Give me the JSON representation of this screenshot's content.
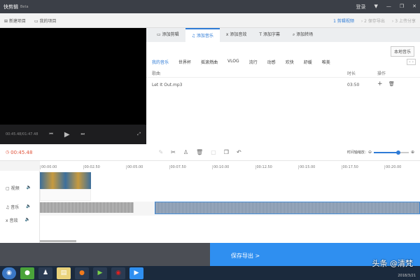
{
  "app": {
    "title": "快剪辑",
    "badge": "Beta",
    "login": "登录",
    "win_controls": [
      "▼",
      "—",
      "❐",
      "✕"
    ]
  },
  "toolbar": {
    "new_project": "新建项目",
    "my_projects": "我的项目",
    "steps": [
      {
        "num": "1",
        "label": "剪辑视频"
      },
      {
        "num": "2",
        "label": "保存导出"
      },
      {
        "num": "3",
        "label": "上传分享"
      }
    ]
  },
  "player": {
    "time": "00:45.48/01:47.48"
  },
  "tabs": [
    "添加剪辑",
    "添加音乐",
    "添加音效",
    "添加字幕",
    "添加转场"
  ],
  "active_tab": 1,
  "music": {
    "local_button": "本地音乐",
    "categories": [
      "我的音乐",
      "世界杯",
      "摇滚燃曲",
      "VLOG",
      "流行",
      "动感",
      "欢快",
      "舒缓",
      "唯美"
    ],
    "columns": [
      "歌曲",
      "时长",
      "操作"
    ],
    "rows": [
      {
        "name": "Let It Out.mp3",
        "duration": "03:50"
      }
    ]
  },
  "timeline": {
    "current": "00:45.48",
    "zoom_label": "时间轴缩放：",
    "zoom_level": 0.7,
    "ticks": [
      "00:00.00",
      "00:02.50",
      "00:05.00",
      "00:07.50",
      "00:10.00",
      "00:12.50",
      "00:15.00",
      "00:17.50",
      "00:20.00"
    ],
    "tracks": [
      "视频",
      "音乐",
      "音效"
    ]
  },
  "export": {
    "label": "保存导出 >"
  },
  "watermark": "头条 @清梵",
  "date": "2018/3/21",
  "colors": {
    "accent": "#2e7bd6",
    "export": "#2f8ff0",
    "time": "#e0533a"
  }
}
